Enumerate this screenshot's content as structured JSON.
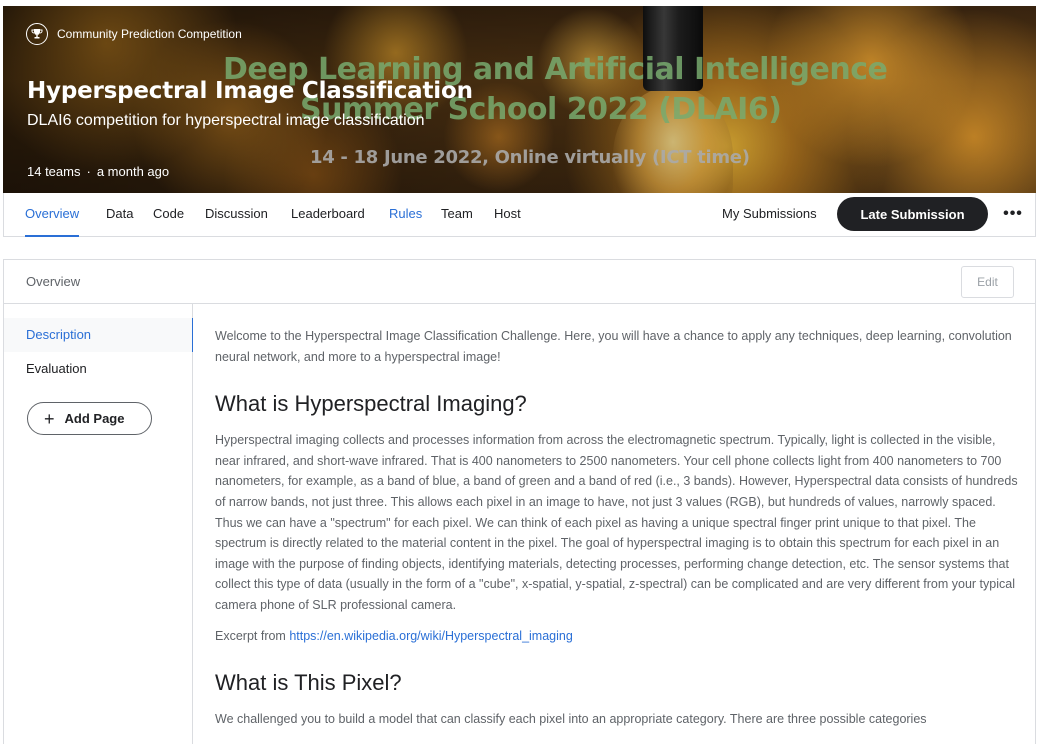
{
  "banner": {
    "competition_type": "Community Prediction Competition",
    "title": "Hyperspectral Image Classification",
    "subtitle": "DLAI6 competition for hyperspectral image classification",
    "teams": "14 teams",
    "separator": "·",
    "time_ago": "a month ago",
    "image_text_line1": "Deep Learning and Artificial Intelligence",
    "image_text_line2": "Summer School 2022 (DLAI6)",
    "image_text_line3": "14 - 18 June 2022, Online virtually (ICT time)"
  },
  "tabs": [
    {
      "label": "Overview"
    },
    {
      "label": "Data"
    },
    {
      "label": "Code"
    },
    {
      "label": "Discussion"
    },
    {
      "label": "Leaderboard"
    },
    {
      "label": "Rules"
    },
    {
      "label": "Team"
    },
    {
      "label": "Host"
    }
  ],
  "actions": {
    "my_submissions": "My Submissions",
    "late_submission": "Late Submission",
    "more": "•••"
  },
  "overview": {
    "header": "Overview",
    "edit": "Edit",
    "nav": [
      {
        "label": "Description"
      },
      {
        "label": "Evaluation"
      }
    ],
    "add_page": "Add Page"
  },
  "content": {
    "intro": "Welcome to the Hyperspectral Image Classification Challenge. Here, you will have a chance to apply any techniques, deep learning, convolution neural network, and more to a hyperspectral image!",
    "h_imaging": "What is Hyperspectral Imaging?",
    "imaging_body": "Hyperspectral imaging collects and processes information from across the electromagnetic spectrum. Typically, light is collected in the visible, near infrared, and short-wave infrared. That is 400 nanometers to 2500 nanometers. Your cell phone collects light from 400 nanometers to 700 nanometers, for example, as a band of blue, a band of green and a band of red (i.e., 3 bands). However, Hyperspectral data consists of hundreds of narrow bands, not just three. This allows each pixel in an image to have, not just 3 values (RGB), but hundreds of values, narrowly spaced. Thus we can have a \"spectrum\" for each pixel. We can think of each pixel as having a unique spectral finger print unique to that pixel. The spectrum is directly related to the material content in the pixel. The goal of hyperspectral imaging is to obtain this spectrum for each pixel in an image with the purpose of finding objects, identifying materials, detecting processes, performing change detection, etc. The sensor systems that collect this type of data (usually in the form of a \"cube\", x-spatial, y-spatial, z-spectral) can be complicated and are very different from your typical camera phone of SLR professional camera.",
    "excerpt_prefix": "Excerpt from ",
    "excerpt_link": "https://en.wikipedia.org/wiki/Hyperspectral_imaging",
    "h_pixel": "What is This Pixel?",
    "pixel_body": "We challenged you to build a model that can classify each pixel into an appropriate category. There are three possible categories"
  },
  "colors": {
    "accent": "#2a6fd6",
    "button_dark": "#202124",
    "muted_text": "#5f6368",
    "border": "#dadce0"
  }
}
